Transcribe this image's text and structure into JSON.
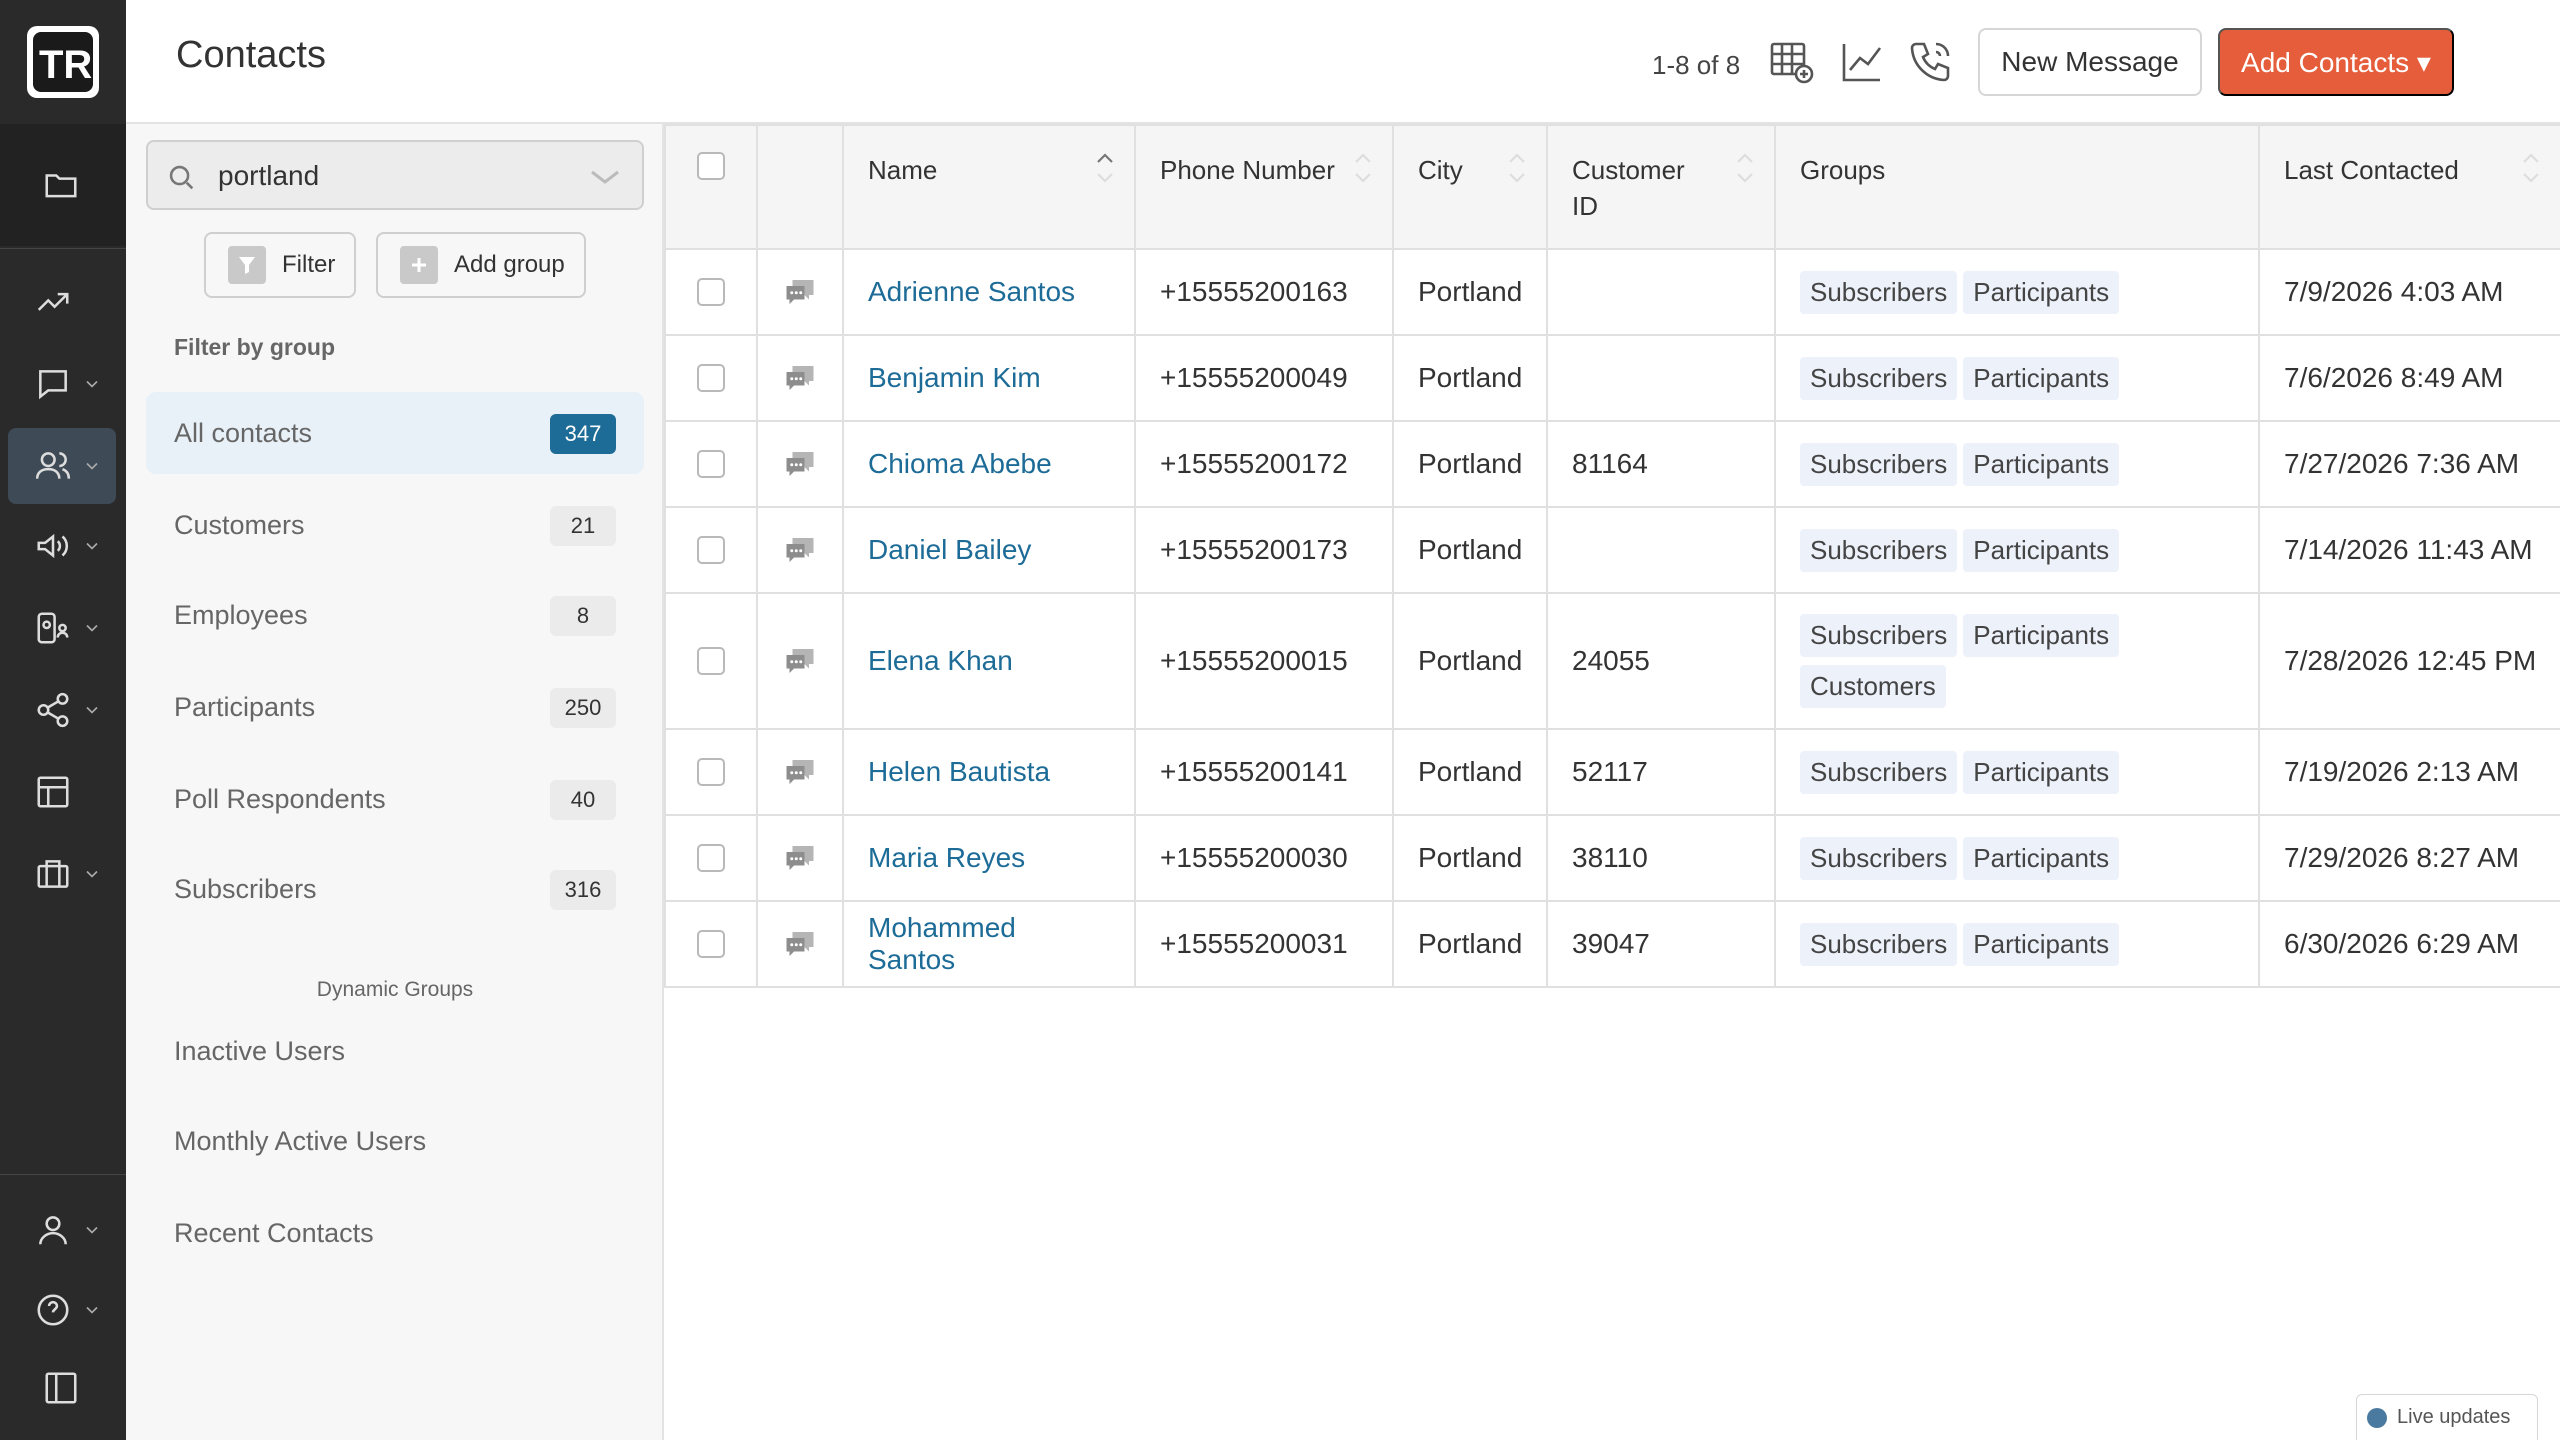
{
  "header": {
    "title": "Contacts",
    "pager": "1-8 of 8",
    "new_message_label": "New Message",
    "add_contacts_label": "Add Contacts ▾"
  },
  "search": {
    "value": "portland"
  },
  "sidebar": {
    "filter_label": "Filter",
    "add_group_label": "Add group",
    "filter_heading": "Filter by group",
    "groups": [
      {
        "label": "All contacts",
        "count": "347"
      },
      {
        "label": "Customers",
        "count": "21"
      },
      {
        "label": "Employees",
        "count": "8"
      },
      {
        "label": "Participants",
        "count": "250"
      },
      {
        "label": "Poll Respondents",
        "count": "40"
      },
      {
        "label": "Subscribers",
        "count": "316"
      }
    ],
    "dynamic_heading": "Dynamic Groups",
    "dynamic_groups": [
      {
        "label": "Inactive Users"
      },
      {
        "label": "Monthly Active Users"
      },
      {
        "label": "Recent Contacts"
      }
    ]
  },
  "table": {
    "columns": {
      "name": "Name",
      "phone": "Phone Number",
      "city": "City",
      "customer_id": "Customer ID",
      "groups": "Groups",
      "last_contacted": "Last Contacted"
    },
    "rows": [
      {
        "name": "Adrienne Santos",
        "phone": "+15555200163",
        "city": "Portland",
        "customer_id": "",
        "groups": [
          "Subscribers",
          "Participants"
        ],
        "last": "7/9/2026 4:03 AM"
      },
      {
        "name": "Benjamin Kim",
        "phone": "+15555200049",
        "city": "Portland",
        "customer_id": "",
        "groups": [
          "Subscribers",
          "Participants"
        ],
        "last": "7/6/2026 8:49 AM"
      },
      {
        "name": "Chioma Abebe",
        "phone": "+15555200172",
        "city": "Portland",
        "customer_id": "81164",
        "groups": [
          "Subscribers",
          "Participants"
        ],
        "last": "7/27/2026 7:36 AM"
      },
      {
        "name": "Daniel Bailey",
        "phone": "+15555200173",
        "city": "Portland",
        "customer_id": "",
        "groups": [
          "Subscribers",
          "Participants"
        ],
        "last": "7/14/2026 11:43 AM"
      },
      {
        "name": "Elena Khan",
        "phone": "+15555200015",
        "city": "Portland",
        "customer_id": "24055",
        "groups": [
          "Subscribers",
          "Participants",
          "Customers"
        ],
        "last": "7/28/2026 12:45 PM"
      },
      {
        "name": "Helen Bautista",
        "phone": "+15555200141",
        "city": "Portland",
        "customer_id": "52117",
        "groups": [
          "Subscribers",
          "Participants"
        ],
        "last": "7/19/2026 2:13 AM"
      },
      {
        "name": "Maria Reyes",
        "phone": "+15555200030",
        "city": "Portland",
        "customer_id": "38110",
        "groups": [
          "Subscribers",
          "Participants"
        ],
        "last": "7/29/2026 8:27 AM"
      },
      {
        "name": "Mohammed Santos",
        "phone": "+15555200031",
        "city": "Portland",
        "customer_id": "39047",
        "groups": [
          "Subscribers",
          "Participants"
        ],
        "last": "6/30/2026 6:29 AM"
      }
    ]
  },
  "footer": {
    "live_updates": "Live updates"
  },
  "icons": {
    "rail": [
      "folder-icon",
      "trending-icon",
      "chat-icon",
      "contacts-icon",
      "megaphone-icon",
      "people-settings-icon",
      "share-icon",
      "table-icon",
      "briefcase-icon",
      "user-icon",
      "help-icon",
      "sidebar-toggle-icon"
    ],
    "header": [
      "table-add-icon",
      "line-chart-icon",
      "phone-icon",
      "kebab-menu-icon"
    ]
  },
  "colors": {
    "accent": "#e55d3a",
    "link": "#1d6b97",
    "rail_bg": "#2a2a2a",
    "active_badge": "#1d6b97"
  }
}
